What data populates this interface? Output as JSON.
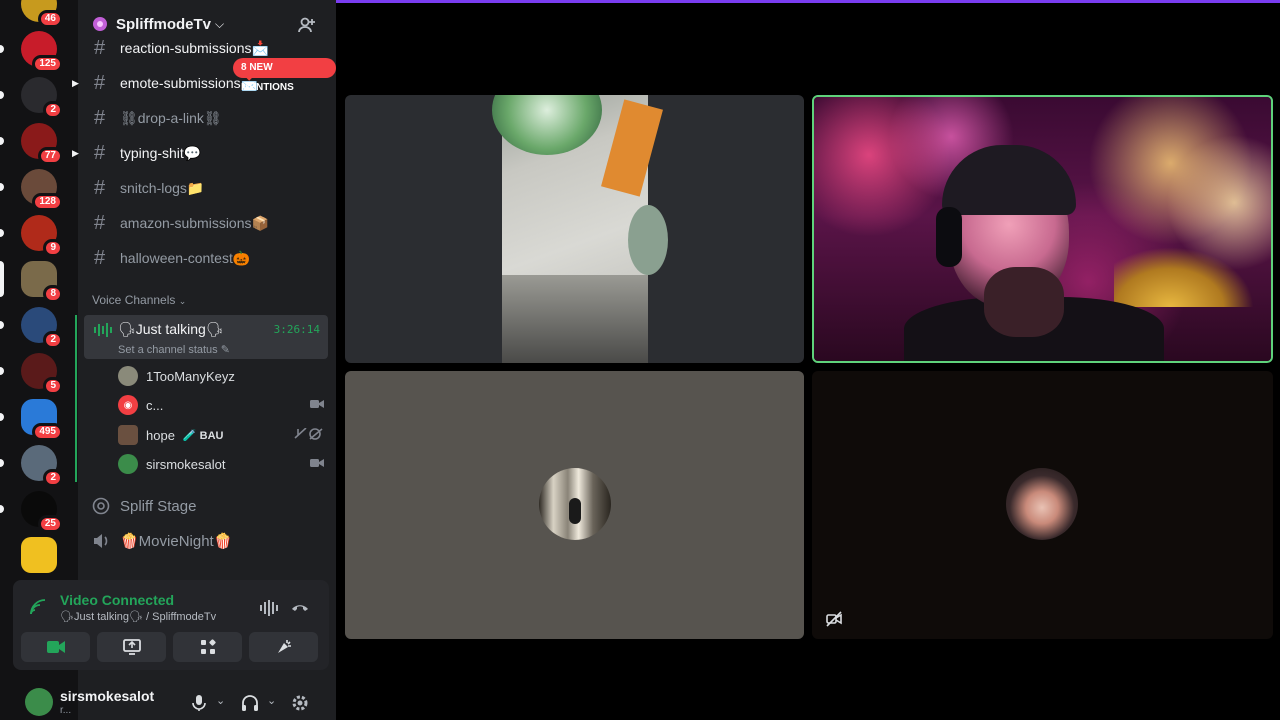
{
  "server": {
    "name": "SpliffmodeTv"
  },
  "rail": {
    "badges": [
      "46",
      "125",
      "2",
      "77",
      "128",
      "9",
      "8",
      "2",
      "5",
      "495",
      "2",
      "25"
    ]
  },
  "channels": [
    {
      "name": "reaction-submissions📩",
      "bright": true
    },
    {
      "name": "emote-submissions📩",
      "bright": true
    },
    {
      "name": "⛓drop-a-link⛓",
      "bright": false
    },
    {
      "name": "typing-shit💬",
      "bright": true
    },
    {
      "name": "snitch-logs📁",
      "bright": false
    },
    {
      "name": "amazon-submissions📦",
      "bright": false
    },
    {
      "name": "halloween-contest🎃",
      "bright": false
    }
  ],
  "mentions_pill": "8 NEW MENTIONS",
  "voice_header": "Voice Channels",
  "voice_channel": {
    "name": "🗣Just talking🗣",
    "timer": "3:26:14",
    "status_placeholder": "Set a channel status"
  },
  "members": [
    {
      "name": "1TooManyKeyz"
    },
    {
      "name": "c..."
    },
    {
      "name": "hope",
      "tag": "🧪 BAU"
    },
    {
      "name": "sirsmokesalot"
    }
  ],
  "other_voice": [
    {
      "name": "Spliff Stage"
    },
    {
      "name": "🍿MovieNight🍿"
    }
  ],
  "connection": {
    "title": "Video Connected",
    "subtitle": "🗣Just talking🗣 / SpliffmodeTv"
  },
  "user": {
    "name": "sirsmokesalot",
    "status": "r..."
  },
  "colors": {
    "accent_green": "#23a55a",
    "speaking_border": "#5fd27b",
    "badge_red": "#f23f43",
    "top_bar": "#7a3df0"
  }
}
